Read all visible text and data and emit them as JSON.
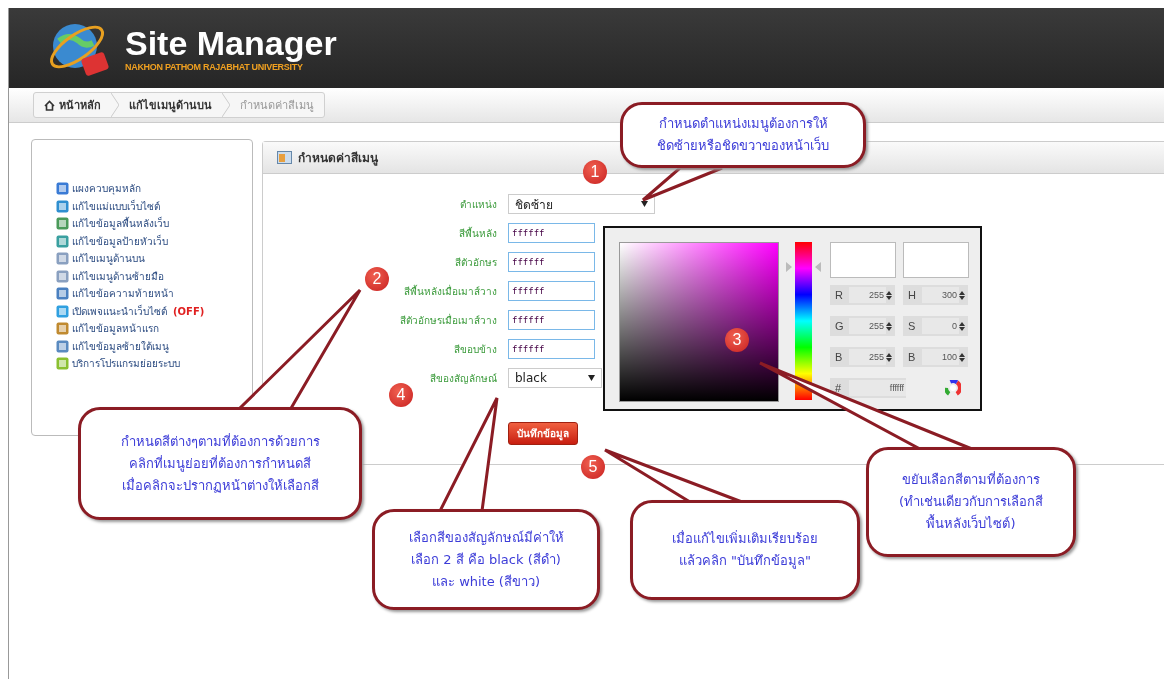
{
  "header": {
    "title": "Site Manager",
    "subtitle": "NAKHON PATHOM RAJABHAT UNIVERSITY"
  },
  "breadcrumb": [
    {
      "label": "หน้าหลัก",
      "kind": "home",
      "selected": false
    },
    {
      "label": "แก้ไขเมนูด้านบน",
      "kind": "link",
      "selected": false
    },
    {
      "label": "กำหนดค่าสีเมนู",
      "kind": "link",
      "selected": true
    }
  ],
  "sidebar": {
    "items": [
      {
        "label": "แผงควบคุมหลัก"
      },
      {
        "label": "แก้ไขแม่แบบเว็บไซต์"
      },
      {
        "label": "แก้ไขข้อมูลพื้นหลังเว็บ"
      },
      {
        "label": "แก้ไขข้อมูลป้ายหัวเว็บ"
      },
      {
        "label": "แก้ไขเมนูด้านบน"
      },
      {
        "label": "แก้ไขเมนูด้านซ้ายมือ"
      },
      {
        "label": "แก้ไขข้อความท้ายหน้า"
      },
      {
        "label": "เปิดเพจแนะนำเว็บไซต์",
        "badge": "(OFF)"
      },
      {
        "label": "แก้ไขข้อมูลหน้าแรก"
      },
      {
        "label": "แก้ไขข้อมูลซ้ายใต้เมนู"
      },
      {
        "label": "บริการโปรแกรมย่อยระบบ"
      }
    ]
  },
  "panel": {
    "title": "กำหนดค่าสีเมนู",
    "fields": [
      {
        "label": "ตำแหน่ง",
        "kind": "select",
        "value": "ชิดซ้าย"
      },
      {
        "label": "สีพื้นหลัง",
        "kind": "text",
        "value": "ffffff"
      },
      {
        "label": "สีตัวอักษร",
        "kind": "text",
        "value": "ffffff"
      },
      {
        "label": "สีพื้นหลังเมื่อเมาส์วาง",
        "kind": "text",
        "value": "ffffff"
      },
      {
        "label": "สีตัวอักษรเมื่อเมาส์วาง",
        "kind": "text",
        "value": "ffffff"
      },
      {
        "label": "สีขอบข้าง",
        "kind": "text",
        "value": "ffffff"
      },
      {
        "label": "สีของสัญลักษณ์",
        "kind": "selectsmall",
        "value": "black"
      }
    ],
    "save_button": "บันทึกข้อมูล"
  },
  "color_picker": {
    "channels": [
      {
        "label": "R",
        "value": "255"
      },
      {
        "label": "H",
        "value": "300"
      },
      {
        "label": "G",
        "value": "255"
      },
      {
        "label": "S",
        "value": "0"
      },
      {
        "label": "B",
        "value": "255"
      },
      {
        "label": "B",
        "value": "100"
      }
    ],
    "hex_label": "#",
    "hex": "ffffff",
    "hue_slider": {
      "level": 0.84
    }
  },
  "steps": [
    "1",
    "2",
    "3",
    "4",
    "5"
  ],
  "callouts": [
    {
      "lines": [
        "กำหนดตำแหน่งเมนูต้องการให้",
        "ชิดซ้ายหรือชิดขวาของหน้าเว็บ"
      ]
    },
    {
      "lines": [
        "กำหนดสีต่างๆตามที่ต้องการด้วยการ",
        "คลิกที่เมนูย่อยที่ต้องการกำหนดสี",
        "เมื่อคลิกจะปรากฏหน้าต่างให้เลือกสี"
      ]
    },
    {
      "lines": [
        "ขยับเลือกสีตามที่ต้องการ",
        "(ทำเช่นเดียวกับการเลือกสี",
        "พื้นหลังเว็บไซต์)"
      ]
    },
    {
      "lines": [
        "เลือกสีของสัญลักษณ์มีค่าให้",
        "เลือก 2 สี คือ black (สีดำ)",
        "และ white (สีขาว)"
      ]
    },
    {
      "lines": [
        "เมื่อแก้ไขเพิ่มเติมเรียบร้อย",
        "แล้วคลิก \"บันทึกข้อมูล\""
      ]
    }
  ]
}
